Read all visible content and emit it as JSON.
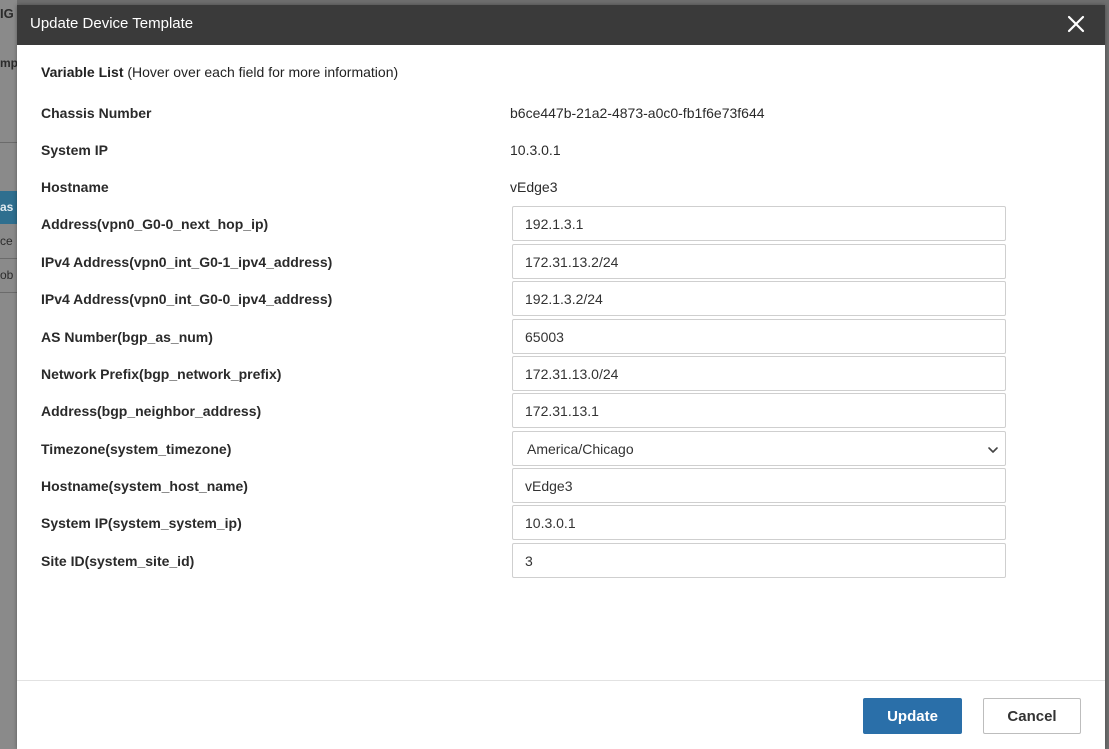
{
  "background": {
    "fragments": [
      "IG",
      "mp",
      "as",
      "ce",
      "ob"
    ]
  },
  "modal": {
    "title": "Update Device Template",
    "heading": "Variable List",
    "heading_hint": "(Hover over each field for more information)",
    "static_rows": [
      {
        "label": "Chassis Number",
        "value": "b6ce447b-21a2-4873-a0c0-fb1f6e73f644"
      },
      {
        "label": "System IP",
        "value": "10.3.0.1"
      },
      {
        "label": "Hostname",
        "value": "vEdge3"
      }
    ],
    "fields": [
      {
        "label": "Address(vpn0_G0-0_next_hop_ip)",
        "value": "192.1.3.1"
      },
      {
        "label": "IPv4 Address(vpn0_int_G0-1_ipv4_address)",
        "value": "172.31.13.2/24"
      },
      {
        "label": "IPv4 Address(vpn0_int_G0-0_ipv4_address)",
        "value": "192.1.3.2/24"
      },
      {
        "label": "AS Number(bgp_as_num)",
        "value": "65003"
      },
      {
        "label": "Network Prefix(bgp_network_prefix)",
        "value": "172.31.13.0/24"
      },
      {
        "label": "Address(bgp_neighbor_address)",
        "value": "172.31.13.1"
      },
      {
        "label": "Timezone(system_timezone)",
        "value": "America/Chicago"
      },
      {
        "label": "Hostname(system_host_name)",
        "value": "vEdge3"
      },
      {
        "label": "System IP(system_system_ip)",
        "value": "10.3.0.1"
      },
      {
        "label": "Site ID(system_site_id)",
        "value": "3"
      }
    ],
    "buttons": {
      "update": "Update",
      "cancel": "Cancel"
    }
  },
  "icons": {
    "close": "close-icon",
    "dropdown": "chevron-down-icon"
  },
  "colors": {
    "header_bg": "#3a3a3a",
    "primary": "#2a6fa9"
  }
}
